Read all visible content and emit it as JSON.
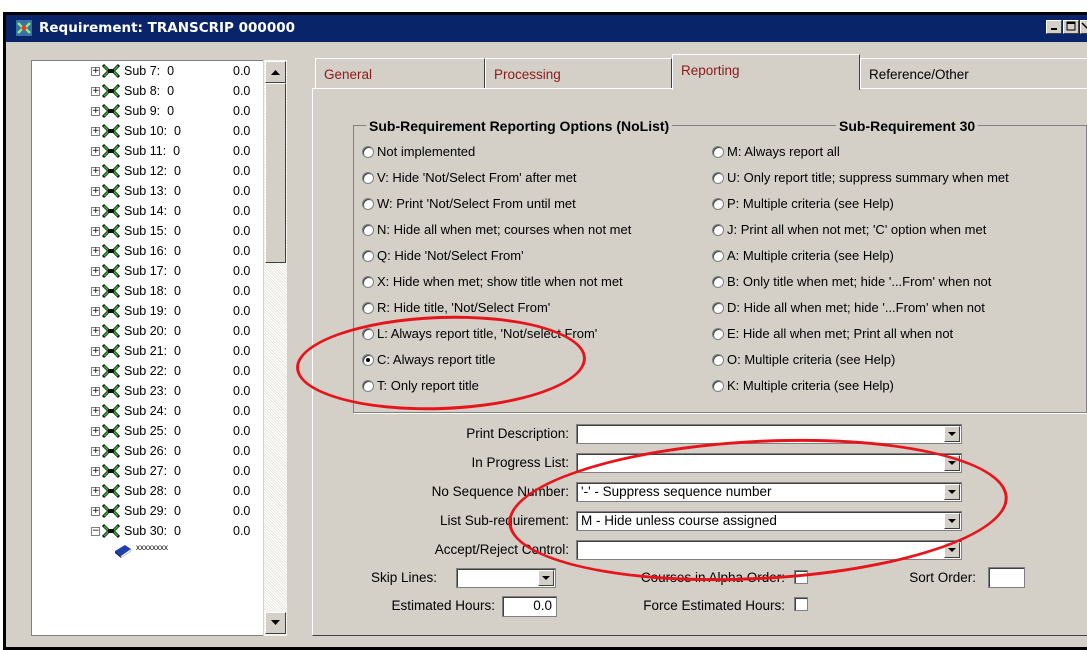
{
  "window": {
    "title": "Requirement: TRANSCRIP 000000",
    "controls": [
      "minimize",
      "maximize"
    ]
  },
  "tree": {
    "items": [
      {
        "label": "Sub 7:  0",
        "value": "0.0"
      },
      {
        "label": "Sub 8:  0",
        "value": "0.0"
      },
      {
        "label": "Sub 9:  0",
        "value": "0.0"
      },
      {
        "label": "Sub 10:  0",
        "value": "0.0"
      },
      {
        "label": "Sub 11:  0",
        "value": "0.0"
      },
      {
        "label": "Sub 12:  0",
        "value": "0.0"
      },
      {
        "label": "Sub 13:  0",
        "value": "0.0"
      },
      {
        "label": "Sub 14:  0",
        "value": "0.0"
      },
      {
        "label": "Sub 15:  0",
        "value": "0.0"
      },
      {
        "label": "Sub 16:  0",
        "value": "0.0"
      },
      {
        "label": "Sub 17:  0",
        "value": "0.0"
      },
      {
        "label": "Sub 18:  0",
        "value": "0.0"
      },
      {
        "label": "Sub 19:  0",
        "value": "0.0"
      },
      {
        "label": "Sub 20:  0",
        "value": "0.0"
      },
      {
        "label": "Sub 21:  0",
        "value": "0.0"
      },
      {
        "label": "Sub 22:  0",
        "value": "0.0"
      },
      {
        "label": "Sub 23:  0",
        "value": "0.0"
      },
      {
        "label": "Sub 24:  0",
        "value": "0.0"
      },
      {
        "label": "Sub 25:  0",
        "value": "0.0"
      },
      {
        "label": "Sub 26:  0",
        "value": "0.0"
      },
      {
        "label": "Sub 27:  0",
        "value": "0.0"
      },
      {
        "label": "Sub 28:  0",
        "value": "0.0"
      },
      {
        "label": "Sub 29:  0",
        "value": "0.0"
      },
      {
        "label": "Sub 30:  0",
        "value": "0.0"
      }
    ],
    "child_label": "xxxxxxxx"
  },
  "tabs": {
    "general": "General",
    "processing": "Processing",
    "reporting": "Reporting",
    "reference": "Reference/Other",
    "active": "Reporting"
  },
  "group": {
    "title": "Sub-Requirement Reporting Options (NoList)",
    "subtitle": "Sub-Requirement 30",
    "left_options": [
      "Not implemented",
      "V: Hide 'Not/Select From' after met",
      "W: Print 'Not/Select From until met",
      "N: Hide all when met; courses when not met",
      "Q: Hide 'Not/Select From'",
      "X: Hide when met; show title when not met",
      "R: Hide title, 'Not/Select From'",
      "L: Always report title, 'Not/select From'",
      "C: Always report title",
      "T: Only report title"
    ],
    "right_options": [
      "M: Always report all",
      "U: Only report title; suppress summary when met",
      "P: Multiple criteria (see Help)",
      "J: Print all when not met; 'C' option when met",
      "A: Multiple criteria (see Help)",
      "B: Only title when met; hide '...From' when not",
      "D: Hide all when met; hide '...From' when not",
      "E: Hide all when met; Print all when not",
      "O: Multiple criteria (see Help)",
      "K: Multiple criteria (see Help)"
    ],
    "selected": "C: Always report title"
  },
  "form": {
    "print_description": {
      "label": "Print Description:",
      "value": ""
    },
    "in_progress_list": {
      "label": "In Progress List:",
      "value": ""
    },
    "no_sequence_number": {
      "label": "No Sequence Number:",
      "value": "'-' - Suppress sequence number"
    },
    "list_subrequirement": {
      "label": "List Sub-requirement:",
      "value": "M - Hide unless course assigned"
    },
    "accept_reject": {
      "label": "Accept/Reject Control:",
      "value": ""
    },
    "skip_lines": {
      "label": "Skip Lines:",
      "value": ""
    },
    "courses_alpha": {
      "label": "Courses in Alpha Order:",
      "checked": false
    },
    "sort_order": {
      "label": "Sort Order:",
      "value": ""
    },
    "estimated_hours": {
      "label": "Estimated Hours:",
      "value": "0.0"
    },
    "force_estimated": {
      "label": "Force Estimated Hours:",
      "checked": false
    }
  },
  "colors": {
    "titlebar": "#0a246a",
    "face": "#d4d0c8",
    "annotation": "#e8141b",
    "tab_text": "#8b1a1a"
  }
}
